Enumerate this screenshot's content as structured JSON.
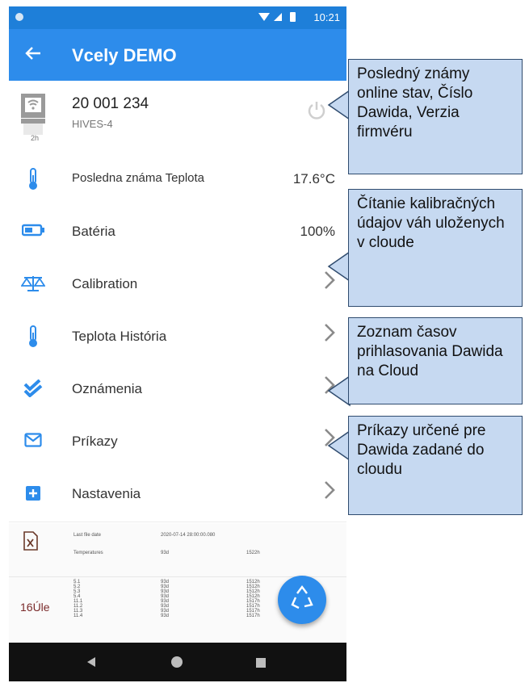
{
  "status_bar": {
    "time": "10:21"
  },
  "app_bar": {
    "title": "Vcely DEMO"
  },
  "device": {
    "id": "20 001 234",
    "model": "HIVES-4",
    "last_seen": "2h"
  },
  "rows": {
    "temperature": {
      "label": "Posledna známa Teplota",
      "value": "17.6°C"
    },
    "battery": {
      "label": "Batéria",
      "value": "100%"
    },
    "calibration": {
      "label": "Calibration"
    },
    "temp_history": {
      "label": "Teplota História"
    },
    "notifications": {
      "label": "Oznámenia"
    },
    "commands": {
      "label": "Príkazy"
    },
    "settings": {
      "label": "Nastavenia"
    }
  },
  "log": {
    "side_label": "16Úle",
    "header_key1": "Last file date",
    "header_val1": "2020-07-14 28:00:00.080",
    "header_key2": "Temperatures",
    "header_val2": "93d",
    "header_val3": "1522h",
    "col1": "5.1\n5.2\n5.3\n5.4\n11.1\n11.2\n11.3\n11.4",
    "col2": "93d\n93d\n93d\n93d\n93d\n93d\n93d\n93d",
    "col3": "1512h\n1512h\n1512h\n1512h\n1517h\n1517h\n1517h\n1517h"
  },
  "callouts": {
    "c1": "Posledný známy online stav, Číslo Dawida, Verzia firmvéru",
    "c2": "Čítanie kalibračných údajov váh uloženych v cloude",
    "c3": "Zoznam časov prihlasovania Dawida na Cloud",
    "c4": "Príkazy určené pre Dawida zadané do cloudu"
  },
  "colors": {
    "accent": "#2d8ceb",
    "callout_fill": "#c6d9f1",
    "callout_border": "#2f4b6e"
  }
}
